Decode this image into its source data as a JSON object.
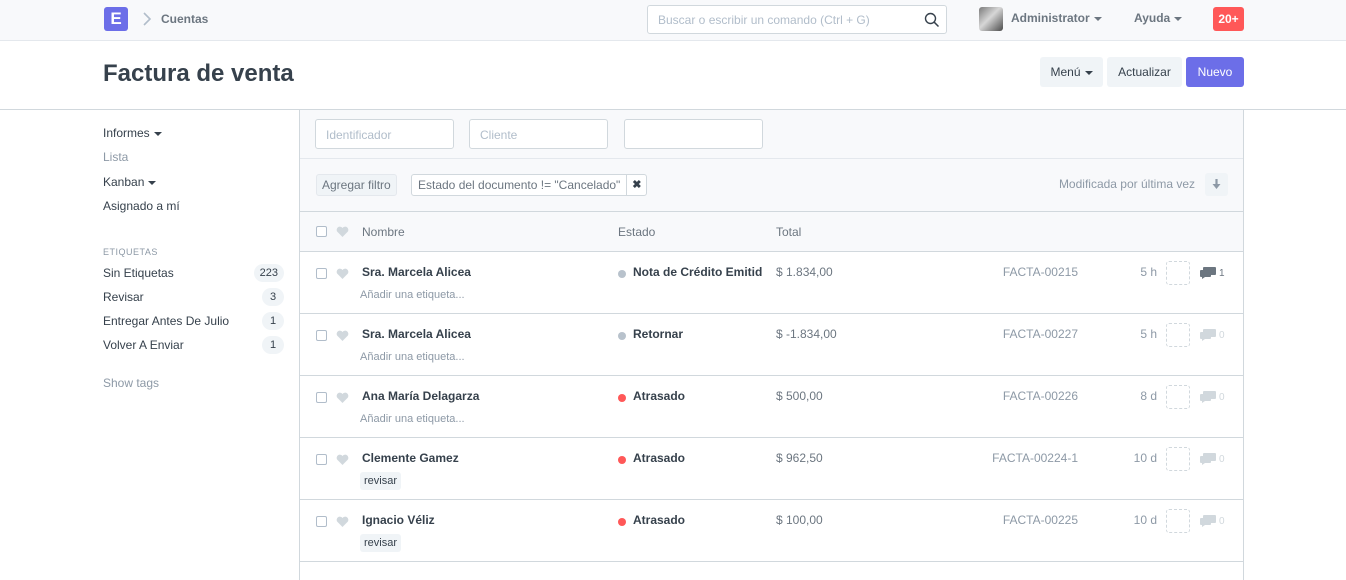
{
  "navbar": {
    "logo_letter": "E",
    "breadcrumb": "Cuentas",
    "search_placeholder": "Buscar o escribir un comando (Ctrl + G)",
    "user": "Administrator",
    "help": "Ayuda",
    "notifications": "20+"
  },
  "page": {
    "title": "Factura de venta",
    "menu_label": "Menú",
    "refresh_label": "Actualizar",
    "new_label": "Nuevo"
  },
  "sidebar": {
    "reports": "Informes",
    "list": "Lista",
    "kanban": "Kanban",
    "assigned": "Asignado a mí",
    "tags_heading": "ETIQUETAS",
    "tags": [
      {
        "label": "Sin Etiquetas",
        "count": "223"
      },
      {
        "label": "Revisar",
        "count": "3"
      },
      {
        "label": "Entregar Antes De Julio",
        "count": "1"
      },
      {
        "label": "Volver A Enviar",
        "count": "1"
      }
    ],
    "show_tags": "Show tags"
  },
  "filters": {
    "id_placeholder": "Identificador",
    "customer_placeholder": "Cliente",
    "third_value": "",
    "add_filter": "Agregar filtro",
    "active_filter": "Estado del documento != \"Cancelado\"",
    "remove_glyph": "✖",
    "sort_label": "Modificada por última vez"
  },
  "table": {
    "headers": {
      "name": "Nombre",
      "status": "Estado",
      "total": "Total"
    },
    "rows": [
      {
        "name": "Sra. Marcela Alicea",
        "sub": "Añadir una etiqueta...",
        "status": "Nota de Crédito Emitida",
        "status_color": "#b8c2cc",
        "total": "$ 1.834,00",
        "ref": "FACTA-00215",
        "age": "5 h",
        "comments": "1"
      },
      {
        "name": "Sra. Marcela Alicea",
        "sub": "Añadir una etiqueta...",
        "status": "Retornar",
        "status_color": "#b8c2cc",
        "total": "$ -1.834,00",
        "ref": "FACTA-00227",
        "age": "5 h",
        "comments": "0"
      },
      {
        "name": "Ana María Delagarza",
        "sub": "Añadir una etiqueta...",
        "status": "Atrasado",
        "status_color": "#ff5858",
        "total": "$ 500,00",
        "ref": "FACTA-00226",
        "age": "8 d",
        "comments": "0"
      },
      {
        "name": "Clemente Gamez",
        "tag": "revisar",
        "status": "Atrasado",
        "status_color": "#ff5858",
        "total": "$ 962,50",
        "ref": "FACTA-00224-1",
        "age": "10 d",
        "comments": "0"
      },
      {
        "name": "Ignacio Véliz",
        "tag": "revisar",
        "status": "Atrasado",
        "status_color": "#ff5858",
        "total": "$ 100,00",
        "ref": "FACTA-00225",
        "age": "10 d",
        "comments": "0"
      }
    ]
  },
  "colors": {
    "accent": "#6c6ee8",
    "danger": "#ff5858",
    "muted": "#b8c2cc"
  }
}
